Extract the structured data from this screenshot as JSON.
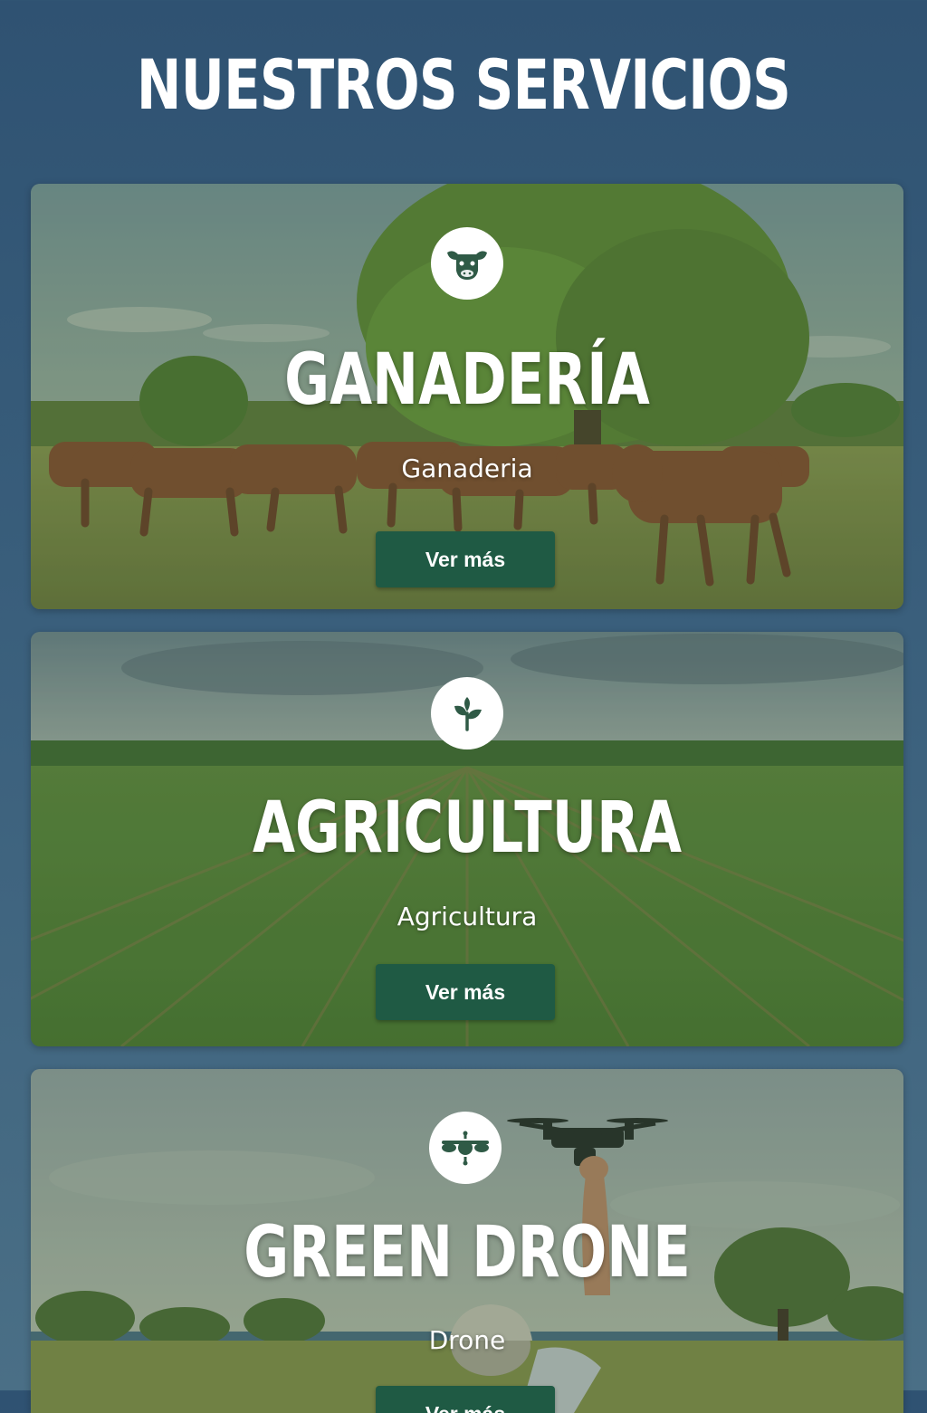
{
  "page": {
    "title": "NUESTROS SERVICIOS"
  },
  "services": [
    {
      "title": "GANADERÍA",
      "subtitle": "Ganaderia",
      "button_label": "Ver más",
      "icon": "cow-icon"
    },
    {
      "title": "AGRICULTURA",
      "subtitle": "Agricultura",
      "button_label": "Ver más",
      "icon": "sprout-icon"
    },
    {
      "title": "GREEN DRONE",
      "subtitle": "Drone",
      "button_label": "Ver más",
      "icon": "drone-icon"
    }
  ],
  "colors": {
    "background": "#2f5272",
    "button": "#1f5a44",
    "icon": "#2f5a46",
    "text": "#ffffff"
  }
}
